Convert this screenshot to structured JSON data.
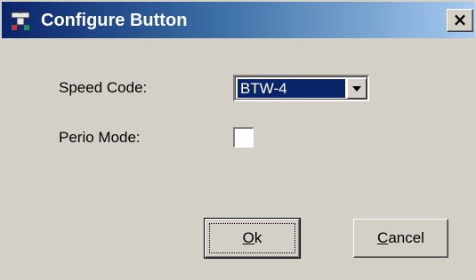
{
  "window": {
    "title": "Configure Button",
    "close_label": "×"
  },
  "form": {
    "speed_code": {
      "label": "Speed Code:",
      "selected": "BTW-4"
    },
    "perio_mode": {
      "label": "Perio Mode:",
      "checked": false
    }
  },
  "buttons": {
    "ok": {
      "mnemonic": "O",
      "rest": "k"
    },
    "cancel": {
      "mnemonic": "C",
      "rest": "ancel"
    }
  },
  "colors": {
    "titlebar_start": "#0a246a",
    "titlebar_end": "#a6caf0",
    "dialog_face": "#d4d0c8",
    "selection": "#0a246a"
  },
  "icons": {
    "app": "dental-chair-icon",
    "close": "close-icon",
    "dropdown": "chevron-down-icon"
  }
}
